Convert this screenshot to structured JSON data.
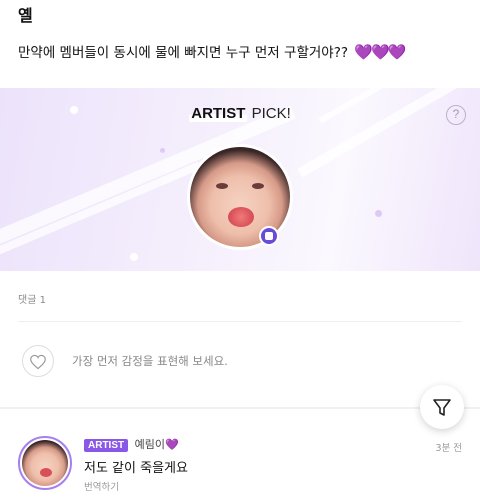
{
  "post": {
    "author_name": "옐",
    "text": "만약에 멤버들이 동시에 물에 빠지면 누구 먼저 구할거야??",
    "hearts": "💜💜💜"
  },
  "artist_pick": {
    "title_artist": "ARTIST",
    "title_pick": "PICK!",
    "help_label": "?",
    "colors": {
      "accent": "#6a4bd8",
      "banner_bg": "#ece3fb"
    }
  },
  "comments_section": {
    "count_label": "댓글 1",
    "reaction_placeholder": "가장 먼저 감정을 표현해 보세요.",
    "reaction_icon": "heart-outline-icon",
    "filter_icon": "filter-icon"
  },
  "comment": {
    "badge": "ARTIST",
    "name": "예림이",
    "heart": "💜",
    "time": "3분 전",
    "text": "저도 같이 죽을게요",
    "translate_label": "번역하기"
  }
}
